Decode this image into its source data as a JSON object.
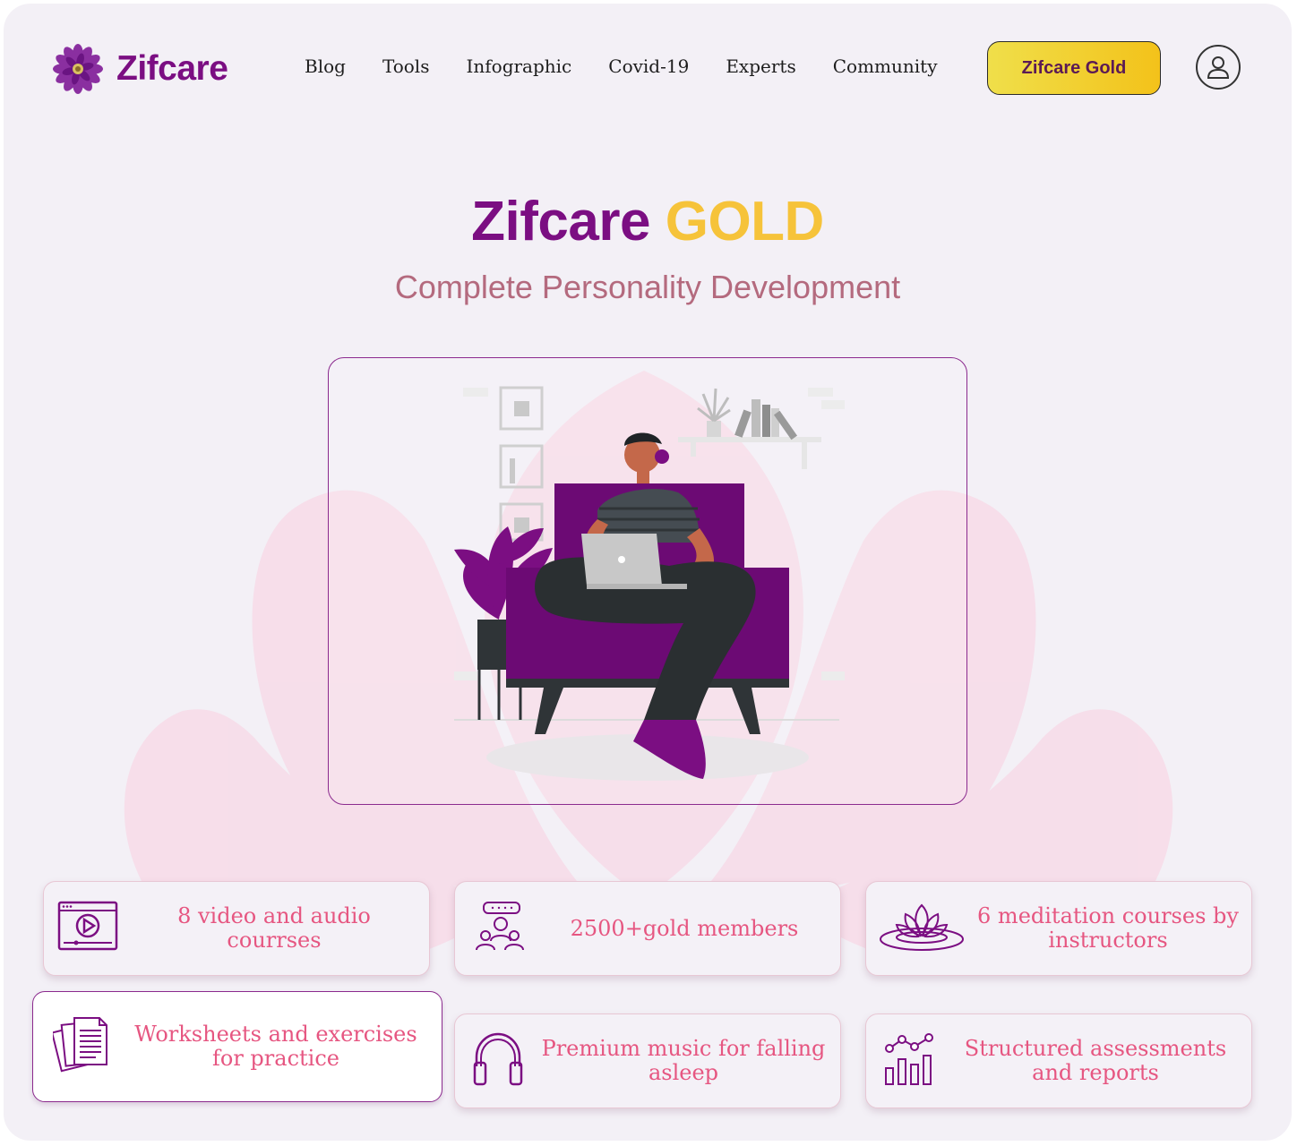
{
  "header": {
    "logo_text": "Zifcare",
    "nav": [
      "Blog",
      "Tools",
      "Infographic",
      "Covid-19",
      "Experts",
      "Community"
    ],
    "gold_button": "Zifcare Gold"
  },
  "hero": {
    "title_main": "Zifcare",
    "title_accent": "GOLD",
    "subtitle": "Complete Personality Development"
  },
  "features": [
    {
      "icon": "video-player-icon",
      "text": "8 video and audio courrses"
    },
    {
      "icon": "members-group-icon",
      "text": "2500+gold members"
    },
    {
      "icon": "lotus-meditation-icon",
      "text": "6 meditation courses by instructors"
    },
    {
      "icon": "worksheets-icon",
      "text": "Worksheets and exercises for practice"
    },
    {
      "icon": "headphones-icon",
      "text": "Premium music for falling asleep"
    },
    {
      "icon": "analytics-chart-icon",
      "text": "Structured assessments and reports"
    }
  ],
  "colors": {
    "brand_purple": "#7b0e82",
    "gold": "#f6c33a",
    "feature_text": "#e65681",
    "subtitle": "#b46a7e"
  }
}
